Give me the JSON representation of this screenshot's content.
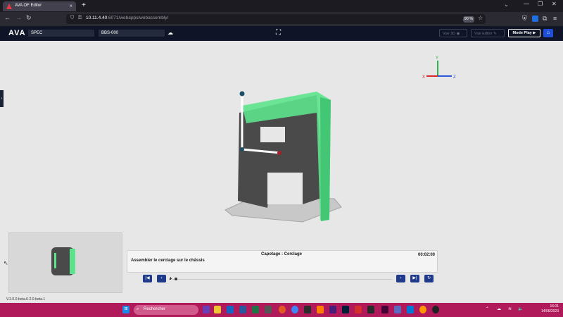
{
  "browser": {
    "tab_title": "AVA OF Editor",
    "tab_close": "×",
    "new_tab": "+",
    "url_host": "10.11.4.40",
    "url_rest": ":6071/webapps/webassembly/",
    "zoom": "90 %"
  },
  "app": {
    "logo": "AVA",
    "spec_field": "SPEC",
    "ref_field": "BBS-000",
    "vue3d_label": "Vue 3D",
    "vue_editor_label": "Vue Editor",
    "mode_play_label": "Mode Play"
  },
  "axes": {
    "x": "X",
    "y": "Y",
    "z": "Z"
  },
  "step": {
    "title": "Capotage : Cerclage",
    "time": "00:02:00",
    "description": "Assembler le cerclage sur le châssis"
  },
  "version": "V.2.0.0-beta.6-2.0-beta.1",
  "taskbar": {
    "search_placeholder": "Rechercher",
    "time": "16:01",
    "date": "14/06/2023"
  },
  "colors": {
    "header_bg": "#0f1526",
    "accent_blue": "#1f4fd6",
    "green_part": "#5ee38d",
    "taskbar": "#b0195a"
  }
}
